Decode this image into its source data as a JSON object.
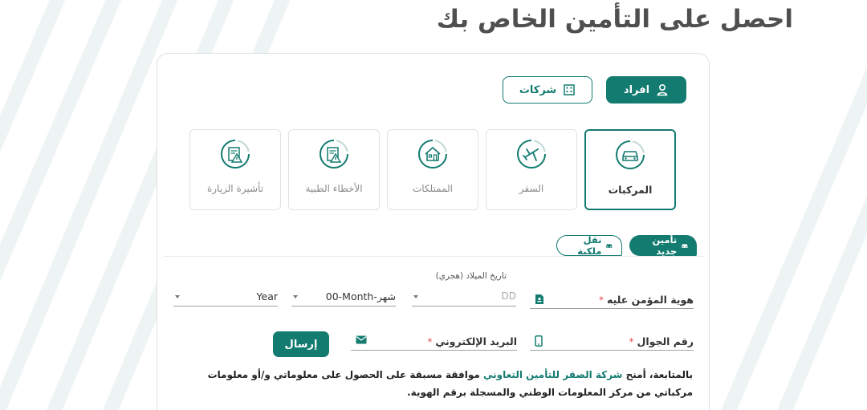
{
  "page": {
    "title": "احصل على التأمين الخاص بك"
  },
  "customer_type": {
    "individuals_label": "افراد",
    "companies_label": "شركات"
  },
  "categories": [
    {
      "label": "المركبات",
      "icon": "car-icon"
    },
    {
      "label": "السفر",
      "icon": "airplane-icon"
    },
    {
      "label": "الممتلكات",
      "icon": "house-icon"
    },
    {
      "label": "الأخطاء الطبية",
      "icon": "medical-report-icon"
    },
    {
      "label": "تأشيرة الزيارة",
      "icon": "visa-report-icon"
    }
  ],
  "insurance_type": {
    "new_label": "تأمين جديد",
    "transfer_label": "نقل ملكية"
  },
  "form": {
    "insured_id_label": "هوية المؤمن عليه",
    "required_mark": "*",
    "dob_caption": "تاريخ الميلاد (هجري)",
    "day_placeholder": "DD",
    "month_value": "00-Month-شهر",
    "year_value": "Year",
    "mobile_label": "رقم الجوال",
    "email_label": "البريد الإلكتروني",
    "send_label": "إرسال"
  },
  "consent": {
    "prefix": "بالمتابعة، أمنح ",
    "company": "شركة الصقر للتأمين التعاوني",
    "rest": " موافقة مسبقة على الحصول على معلوماتي و/أو معلومات مركباتي من مركز المعلومات الوطني والمسجلة برقم الهوية."
  },
  "colors": {
    "primary": "#137b70",
    "title": "#4f4f4f",
    "required": "#e05050",
    "inactive_label": "#8a8a8a"
  }
}
